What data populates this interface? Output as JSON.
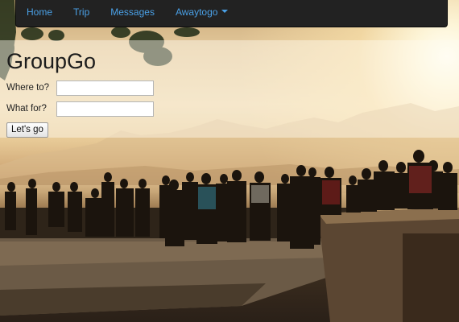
{
  "navbar": {
    "items": [
      {
        "label": "Home"
      },
      {
        "label": "Trip"
      },
      {
        "label": "Messages"
      },
      {
        "label": "Awaytogo",
        "has_dropdown": true
      }
    ],
    "link_color": "#4aa0e6",
    "background": "#222222"
  },
  "main": {
    "title": "GroupGo",
    "form": {
      "where_label": "Where to?",
      "where_value": "",
      "what_label": "What for?",
      "what_value": "",
      "submit_label": "Let's go"
    }
  },
  "background": {
    "icon": "sunset-crowd-photo"
  }
}
